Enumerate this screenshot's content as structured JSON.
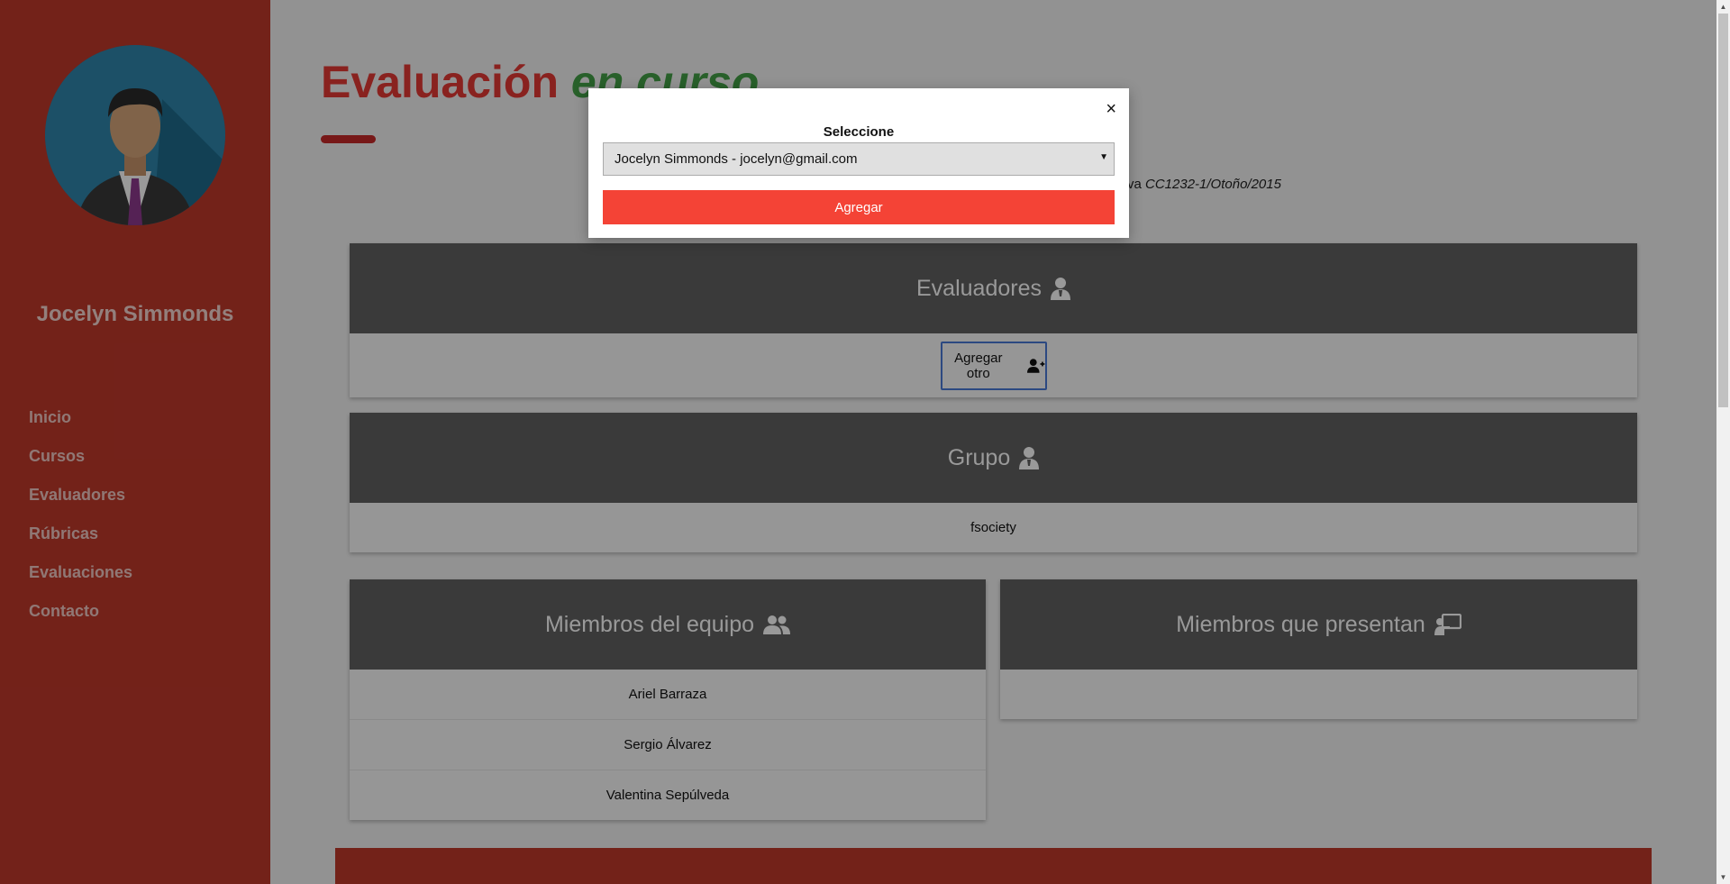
{
  "sidebar": {
    "profile_name": "Jocelyn Simmonds",
    "nav": [
      {
        "label": "Inicio"
      },
      {
        "label": "Cursos"
      },
      {
        "label": "Evaluadores"
      },
      {
        "label": "Rúbricas"
      },
      {
        "label": "Evaluaciones"
      },
      {
        "label": "Contacto"
      }
    ]
  },
  "page": {
    "title_main": "Evaluación",
    "title_accent": "en curso",
    "info_prefix": "ctiva",
    "info_course": "CC1232-1/Otoño/2015"
  },
  "evaluadores": {
    "title": "Evaluadores",
    "add_label": "Agregar otro"
  },
  "grupo": {
    "title": "Grupo",
    "name": "fsociety"
  },
  "miembros": {
    "title": "Miembros del equipo",
    "members": [
      "Ariel Barraza",
      "Sergio Álvarez",
      "Valentina Sepúlveda"
    ]
  },
  "presentan": {
    "title": "Miembros que presentan"
  },
  "modal": {
    "close": "×",
    "label": "Seleccione",
    "selected": "Jocelyn Simmonds - jocelyn@gmail.com",
    "submit": "Agregar"
  },
  "colors": {
    "sidebar": "#c0392b",
    "title_red": "#e53935",
    "title_green": "#43a047",
    "card_header": "#616161",
    "button_red": "#f44336"
  }
}
